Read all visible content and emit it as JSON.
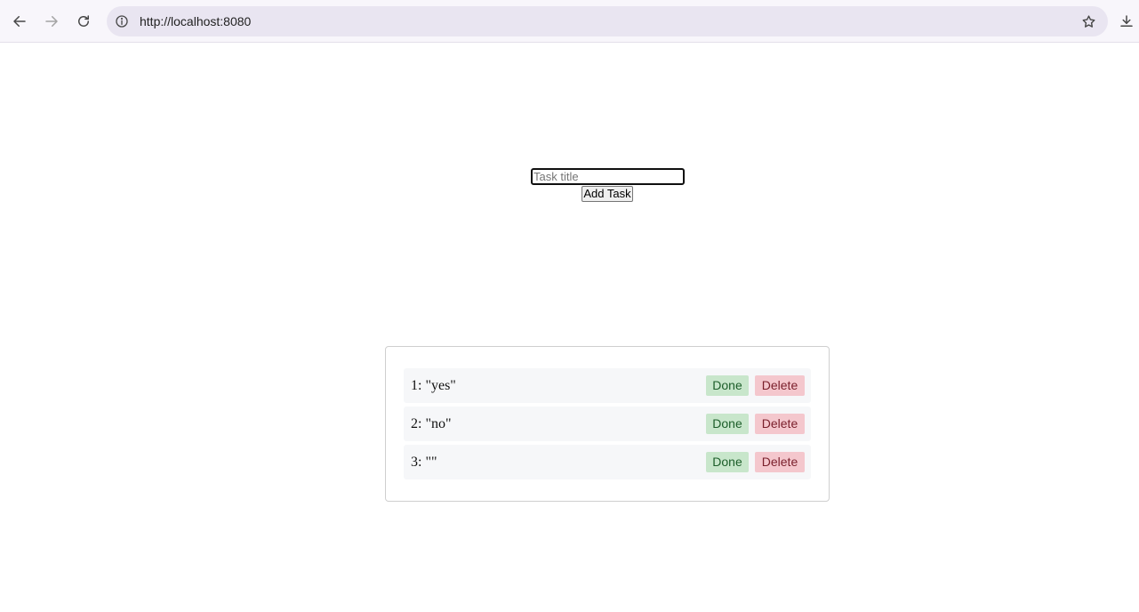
{
  "browser": {
    "url": "http://localhost:8080",
    "icons": {
      "back": "arrow-left-icon",
      "forward": "arrow-right-icon",
      "reload": "reload-icon",
      "site_info": "info-icon",
      "bookmark": "star-icon",
      "download": "download-icon"
    }
  },
  "form": {
    "input_placeholder": "Task title",
    "input_value": "",
    "add_button_label": "Add Task"
  },
  "tasks": [
    {
      "text": "1: \"yes\"",
      "done_label": "Done",
      "delete_label": "Delete"
    },
    {
      "text": "2: \"no\"",
      "done_label": "Done",
      "delete_label": "Delete"
    },
    {
      "text": "3: \"\"",
      "done_label": "Done",
      "delete_label": "Delete"
    }
  ],
  "colors": {
    "done_bg": "#c8e6cb",
    "delete_bg": "#f4c7cd",
    "row_bg": "#f6f7f9"
  }
}
